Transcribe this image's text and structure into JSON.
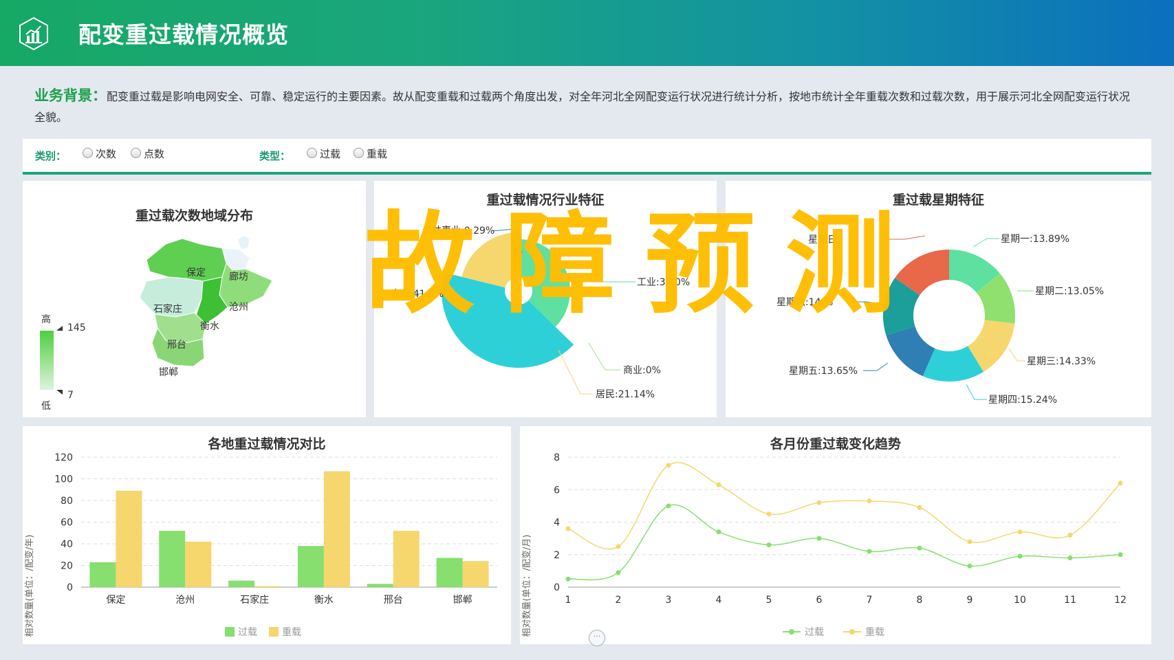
{
  "header": {
    "title": "配变重过载情况概览",
    "logo_icon": "bar-chart-icon"
  },
  "background": {
    "label": "业务背景：",
    "text": "配变重过载是影响电网安全、可靠、稳定运行的主要因素。故从配变重载和过载两个角度出发，对全年河北全网配变运行状况进行统计分析，按地市统计全年重载次数和过载次数，用于展示河北全网配变运行状况全貌。"
  },
  "filters": {
    "category_label": "类别：",
    "category_options": [
      "次数",
      "点数"
    ],
    "type_label": "类型：",
    "type_options": [
      "过载",
      "重载"
    ]
  },
  "map_panel": {
    "title": "重过载次数地域分布",
    "legend_high": "高",
    "legend_low": "低",
    "legend_max": "145",
    "legend_min": "7",
    "regions": [
      "保定",
      "廊坊",
      "石家庄",
      "沧州",
      "衡水",
      "邢台",
      "邯郸"
    ]
  },
  "industry_panel": {
    "title": "重过载情况行业特征",
    "labels": [
      "公共事业:0.29%",
      "工业:37.0%",
      "农业:41.5%",
      "商业:0%",
      "居民:21.14%"
    ]
  },
  "week_panel": {
    "title": "重过载星期特征",
    "labels": [
      "星期日:",
      "星期一:13.89%",
      "星期二:13.05%",
      "星期三:14.33%",
      "星期四:15.24%",
      "星期五:13.65%",
      "星期六:14.%"
    ]
  },
  "watermark": "故障预测",
  "chart_data": [
    {
      "type": "bar",
      "title": "各地重过载情况对比",
      "ylabel": "相对数量(单位：/配变/年)",
      "categories": [
        "保定",
        "沧州",
        "石家庄",
        "衡水",
        "邢台",
        "邯郸"
      ],
      "series": [
        {
          "name": "过载",
          "values": [
            23,
            52,
            6,
            38,
            3,
            27
          ],
          "color": "#86df6e"
        },
        {
          "name": "重载",
          "values": [
            89,
            42,
            1,
            107,
            52,
            24
          ],
          "color": "#f5d76e"
        }
      ],
      "yticks": [
        "0",
        "20",
        "40",
        "60",
        "80",
        "100",
        "120"
      ],
      "ylim": [
        0,
        120
      ]
    },
    {
      "type": "line",
      "title": "各月份重过载变化趋势",
      "ylabel": "相对数量(单位：/配变/月)",
      "x": [
        "1",
        "2",
        "3",
        "4",
        "5",
        "6",
        "7",
        "8",
        "9",
        "10",
        "11",
        "12"
      ],
      "series": [
        {
          "name": "过载",
          "values": [
            0.5,
            0.9,
            5.0,
            3.4,
            2.6,
            3.0,
            2.2,
            2.4,
            1.3,
            1.9,
            1.8,
            2.0
          ],
          "color": "#86df6e"
        },
        {
          "name": "重载",
          "values": [
            3.6,
            2.5,
            7.5,
            6.3,
            4.5,
            5.2,
            5.3,
            4.9,
            2.8,
            3.4,
            3.2,
            6.4
          ],
          "color": "#f5d76e"
        }
      ],
      "yticks": [
        "0",
        "2",
        "4",
        "6",
        "8"
      ],
      "ylim": [
        0,
        8
      ]
    },
    {
      "type": "pie",
      "title": "重过载情况行业特征",
      "slices": [
        {
          "name": "公共事业",
          "value": 0.29,
          "color": "#2a82c0"
        },
        {
          "name": "工业",
          "value": 37.0,
          "color": "#5de0a0"
        },
        {
          "name": "农业",
          "value": 41.5,
          "color": "#2ed0d8"
        },
        {
          "name": "商业",
          "value": 0,
          "color": "#a0e58a"
        },
        {
          "name": "居民",
          "value": 21.14,
          "color": "#f5d76e"
        }
      ]
    },
    {
      "type": "pie",
      "title": "重过载星期特征",
      "slices": [
        {
          "name": "星期一",
          "value": 13.89,
          "color": "#5de0a0"
        },
        {
          "name": "星期二",
          "value": 13.05,
          "color": "#8fe06e"
        },
        {
          "name": "星期三",
          "value": 14.33,
          "color": "#f5d76e"
        },
        {
          "name": "星期四",
          "value": 15.24,
          "color": "#2ed0d8"
        },
        {
          "name": "星期五",
          "value": 13.65,
          "color": "#2f7fb5"
        },
        {
          "name": "星期六",
          "value": 14.5,
          "color": "#1c9e9a"
        },
        {
          "name": "星期日",
          "value": 15.34,
          "color": "#e8684a"
        }
      ]
    }
  ]
}
